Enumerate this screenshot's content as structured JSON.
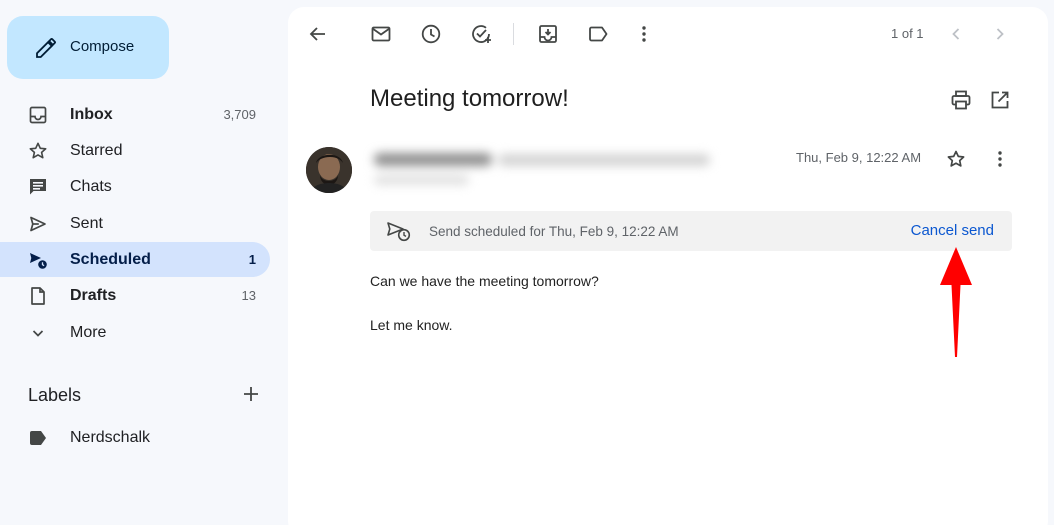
{
  "sidebar": {
    "compose_label": "Compose",
    "items": [
      {
        "label": "Inbox",
        "count": "3,709"
      },
      {
        "label": "Starred",
        "count": ""
      },
      {
        "label": "Chats",
        "count": ""
      },
      {
        "label": "Sent",
        "count": ""
      },
      {
        "label": "Scheduled",
        "count": "1"
      },
      {
        "label": "Drafts",
        "count": "13"
      },
      {
        "label": "More",
        "count": ""
      }
    ],
    "active_item": "Scheduled",
    "labels_header": "Labels",
    "labels": [
      {
        "label": "Nerdschalk"
      }
    ]
  },
  "toolbar": {
    "icons": [
      "back-arrow-icon",
      "mark-unread-icon",
      "snooze-icon",
      "add-to-tasks-icon",
      "move-to-icon",
      "label-icon",
      "more-vert-icon"
    ],
    "pager": "1 of 1"
  },
  "message": {
    "subject": "Meeting tomorrow!",
    "date": "Thu, Feb 9, 12:22 AM",
    "scheduled_text": "Send scheduled for Thu, Feb 9, 12:22 AM",
    "cancel_label": "Cancel send",
    "body": [
      "Can we have the meeting tomorrow?",
      "Let me know."
    ]
  },
  "colors": {
    "accent": "#0b57d0",
    "compose_bg": "#c2e7ff",
    "active_nav_bg": "#d3e3fd",
    "annotation_arrow": "#ff0000"
  }
}
